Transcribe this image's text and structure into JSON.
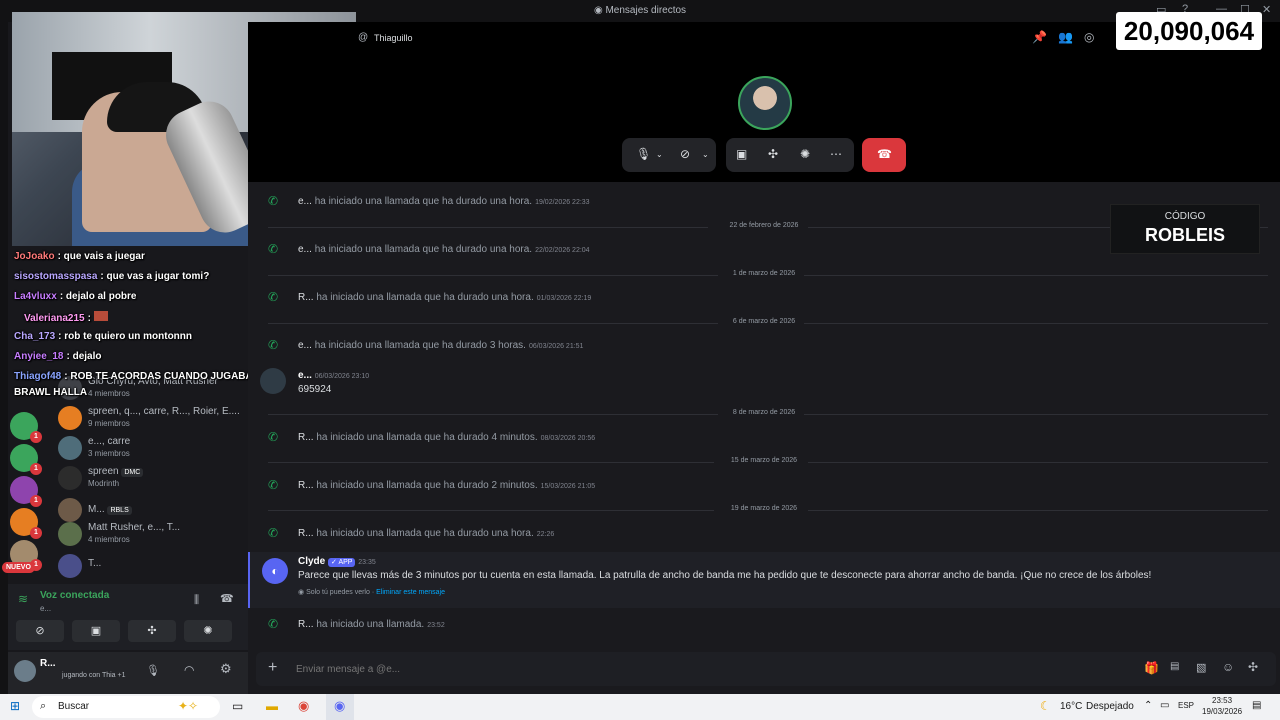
{
  "window": {
    "title": "Mensajes directos"
  },
  "counter": "20,090,064",
  "promo": {
    "label": "CÓDIGO",
    "code": "ROBLEIS"
  },
  "header": {
    "name": "Thiaguillo"
  },
  "sidebar": {
    "chat": [
      {
        "user": "JoJoako",
        "color": "#ff7a7a",
        "text": ": que vais a juegar"
      },
      {
        "user": "sisostomasspasa",
        "color": "#b9a7ff",
        "text": ": que vas a jugar tomi?"
      },
      {
        "user": "La4vluxx",
        "color": "#c77dff",
        "text": ": dejalo al pobre"
      },
      {
        "user": "Valeriana215",
        "color": "#ff9bf2",
        "text": ":"
      },
      {
        "user": "Cha_173",
        "color": "#b9a7ff",
        "text": ": rob te quiero un montonnn"
      },
      {
        "user": "Anyiee_18",
        "color": "#c77dff",
        "text": ": dejalo"
      },
      {
        "user": "Thiagof48",
        "color": "#8aa4ff",
        "text": ": ROB TE ACORDAS CUANDO JUGABAN"
      },
      {
        "user": "",
        "color": "#ffffff",
        "text": "BRAWL HALLA"
      }
    ],
    "dms": [
      {
        "name": "Gio Chyru, Avto, Matt Rusher",
        "sub": "4 miembros"
      },
      {
        "name": "spreen, q..., carre, R..., Roier, E....",
        "sub": "9 miembros"
      },
      {
        "name": "e..., carre",
        "sub": "3 miembros"
      },
      {
        "name": "spreen",
        "tag": "DMC",
        "sub": "Modrinth"
      },
      {
        "name": "M...",
        "tag": "RBLS",
        "sub": ""
      },
      {
        "name": "Matt Rusher, e..., T...",
        "sub": "4 miembros"
      },
      {
        "name": "T...",
        "sub": ""
      }
    ],
    "new_badge": "NUEVO",
    "badge": "1",
    "voice": {
      "status": "Voz conectada",
      "sub": "e..."
    },
    "user": {
      "name": "R...",
      "activity": "jugando con Thia +1"
    }
  },
  "messages": {
    "calls": [
      {
        "who": "e...",
        "text": "ha iniciado una llamada que ha durado una hora.",
        "ts": "19/02/2026 22:33"
      },
      {
        "who": "e...",
        "text": "ha iniciado una llamada que ha durado una hora.",
        "ts": "22/02/2026 22:04"
      },
      {
        "who": "R...",
        "text": "ha iniciado una llamada que ha durado una hora.",
        "ts": "01/03/2026 22:19"
      },
      {
        "who": "e...",
        "text": "ha iniciado una llamada que ha durado 3 horas.",
        "ts": "06/03/2026 21:51"
      },
      {
        "who": "R...",
        "text": "ha iniciado una llamada que ha durado 4 minutos.",
        "ts": "08/03/2026 20:56"
      },
      {
        "who": "R...",
        "text": "ha iniciado una llamada que ha durado 2 minutos.",
        "ts": "15/03/2026 21:05"
      },
      {
        "who": "R...",
        "text": "ha iniciado una llamada que ha durado una hora.",
        "ts": "22:26"
      },
      {
        "who": "R...",
        "text": "ha iniciado una llamada.",
        "ts": "23:52"
      }
    ],
    "dividers": [
      "22 de febrero de 2026",
      "1 de marzo de 2026",
      "6 de marzo de 2026",
      "8 de marzo de 2026",
      "15 de marzo de 2026",
      "19 de marzo de 2026"
    ],
    "text_msg": {
      "author": "e...",
      "time": "06/03/2026 23:10",
      "body": "695924"
    },
    "clyde": {
      "author": "Clyde",
      "tag": "APP",
      "time": "23:35",
      "body": "Parece que llevas más de 3 minutos por tu cuenta en esta llamada. La patrulla de ancho de banda me ha pedido que te desconecte para ahorrar ancho de banda. ¡Que no crece de los árboles!",
      "only_you": "Solo tú puedes verlo",
      "dismiss": "Eliminar este mensaje"
    }
  },
  "composer": {
    "placeholder": "Enviar mensaje a @e..."
  },
  "taskbar": {
    "search": "Buscar",
    "weather": "16°C",
    "weather_desc": "Despejado",
    "lang": "ESP",
    "time": "23:53",
    "date": "19/03/2026"
  }
}
